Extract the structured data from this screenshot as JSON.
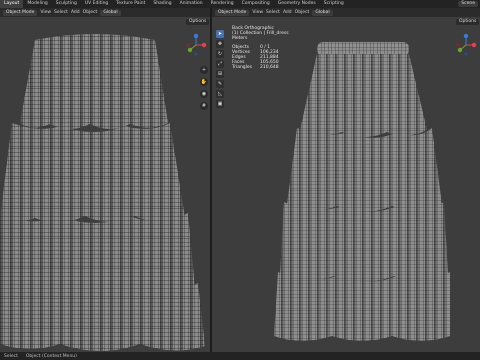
{
  "topbar": {
    "workspaces": [
      "Layout",
      "Modeling",
      "Sculpting",
      "UV Editing",
      "Texture Paint",
      "Shading",
      "Animation",
      "Rendering",
      "Compositing",
      "Geometry Nodes",
      "Scripting"
    ],
    "scene_label": "Scene"
  },
  "left_viewport": {
    "mode": "Object Mode",
    "menus": [
      "View",
      "Select",
      "Add",
      "Object"
    ],
    "transform": "Global",
    "options_label": "Options"
  },
  "right_viewport": {
    "mode": "Object Mode",
    "menus": [
      "View",
      "Select",
      "Add",
      "Object"
    ],
    "transform": "Global",
    "options_label": "Options",
    "overlay": {
      "view_name": "Back Orthographic",
      "collection": "(1) Collection | Frill_dress",
      "units": "Meters",
      "stats": [
        {
          "label": "Objects",
          "value": "0 / 1"
        },
        {
          "label": "Vertices",
          "value": "106,234"
        },
        {
          "label": "Edges",
          "value": "211,884"
        },
        {
          "label": "Faces",
          "value": "105,650"
        },
        {
          "label": "Triangles",
          "value": "210,648"
        }
      ]
    }
  },
  "statusbar": {
    "items": [
      "Select",
      "Object (Context Menu)"
    ]
  },
  "colors": {
    "viewport_bg": "#3d3d3d",
    "mesh_fill": "#8f8f8f",
    "wire": "#2a2a2a",
    "gizmo_x": "#e0444e",
    "gizmo_y": "#6ea32f",
    "gizmo_z": "#3b7be0",
    "active_tool": "#4772b3"
  },
  "icons": [
    "select-cursor-icon",
    "move-icon",
    "rotate-icon",
    "scale-icon",
    "transform-icon",
    "annotate-icon",
    "measure-icon",
    "add-cube-icon",
    "zoom-icon",
    "hand-icon",
    "camera-icon",
    "grid-icon"
  ]
}
